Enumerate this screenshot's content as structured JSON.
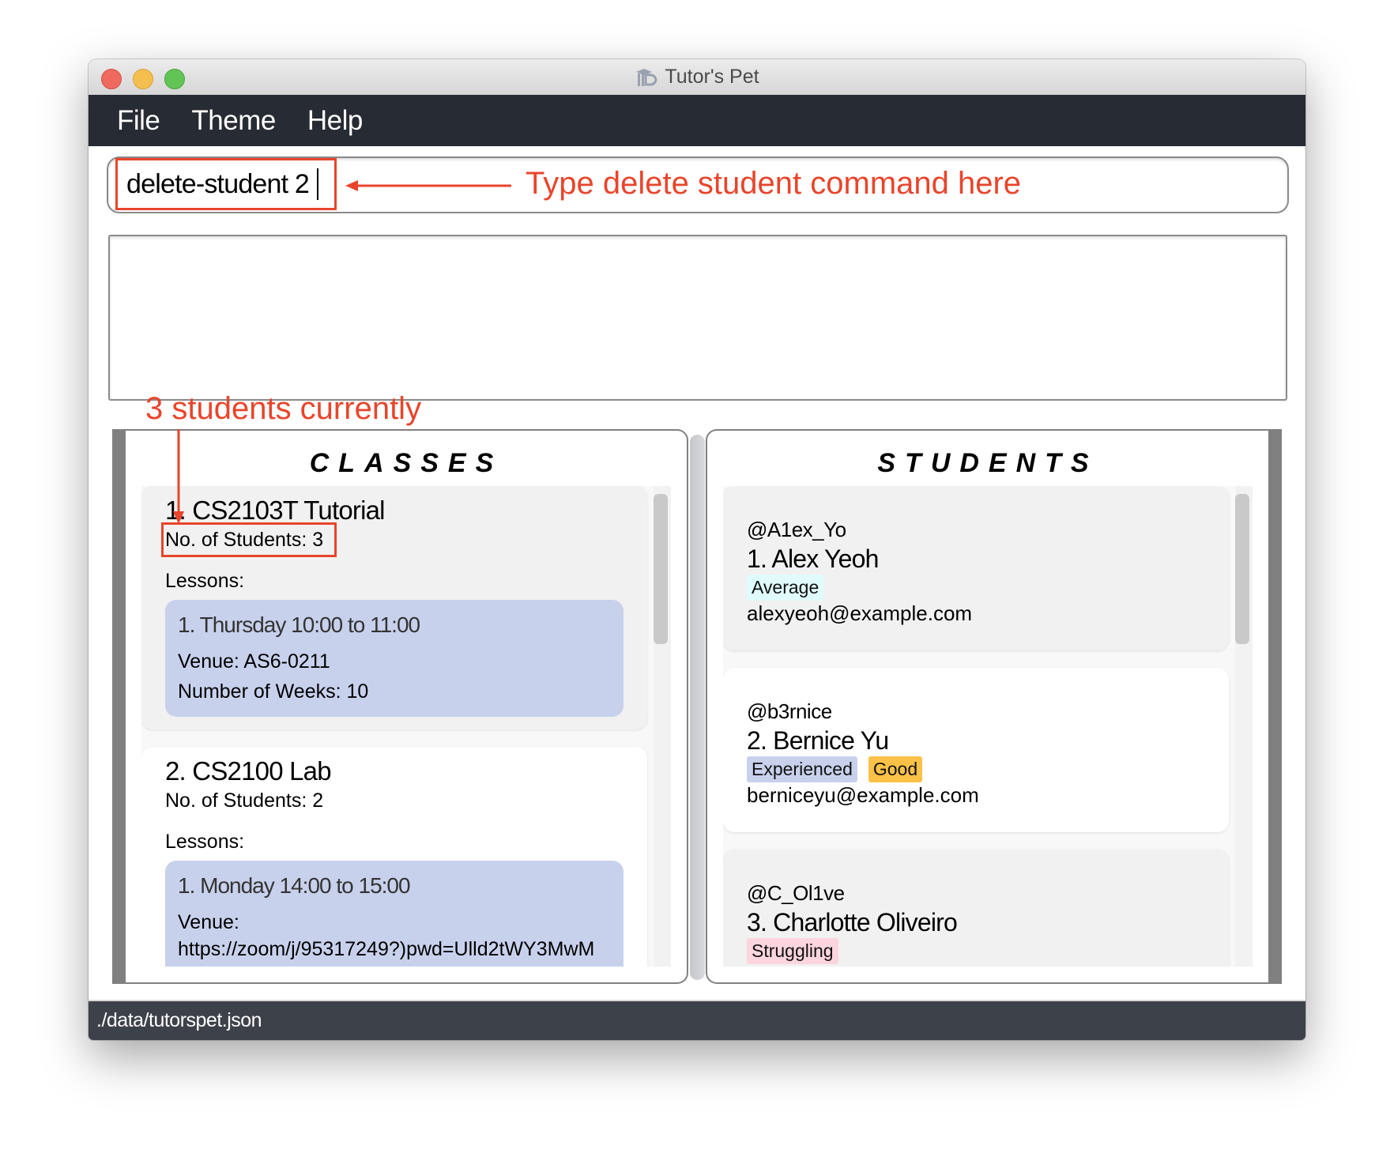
{
  "window": {
    "title": "Tutor's Pet",
    "title_icon": "tutors-pet-logo-icon"
  },
  "menubar": {
    "items": [
      "File",
      "Theme",
      "Help"
    ]
  },
  "command": {
    "value": "delete-student 2",
    "placeholder": ""
  },
  "result_display": {
    "text": ""
  },
  "annotations": {
    "command_hint": "Type delete student command here",
    "students_hint": "3 students currently",
    "color": "#e8452b"
  },
  "classes_panel": {
    "title": "CLASSES",
    "classes": [
      {
        "title": "1.  CS2103T Tutorial",
        "students": "No. of Students:  3",
        "lessons_label": "Lessons:",
        "lessons": [
          {
            "time": "1. Thursday 10:00 to 11:00",
            "venue": "Venue: AS6-0211",
            "weeks": "Number of Weeks: 10"
          }
        ]
      },
      {
        "title": "2.  CS2100 Lab",
        "students": "No. of Students:  2",
        "lessons_label": "Lessons:",
        "lessons": [
          {
            "time": "1. Monday 14:00 to 15:00",
            "venue_label": "Venue:",
            "venue_value": "https://zoom/j/95317249?)pwd=Ulld2tWY3MwM"
          }
        ]
      }
    ]
  },
  "students_panel": {
    "title": "STUDENTS",
    "students": [
      {
        "handle": "@A1ex_Yo",
        "name": "1.  Alex Yeoh",
        "tags": [
          {
            "label": "Average",
            "color": "#e0fbfc"
          }
        ],
        "email": "alexyeoh@example.com"
      },
      {
        "handle": "@b3rnice",
        "name": "2.  Bernice Yu",
        "tags": [
          {
            "label": "Experienced",
            "color": "#c8d1ec"
          },
          {
            "label": "Good",
            "color": "#fcc147"
          }
        ],
        "email": "berniceyu@example.com"
      },
      {
        "handle": "@C_Ol1ve",
        "name": "3.  Charlotte Oliveiro",
        "tags": [
          {
            "label": "Struggling",
            "color": "#fdd5de"
          }
        ],
        "email": ""
      }
    ]
  },
  "statusbar": {
    "path": "./data/tutorspet.json"
  }
}
